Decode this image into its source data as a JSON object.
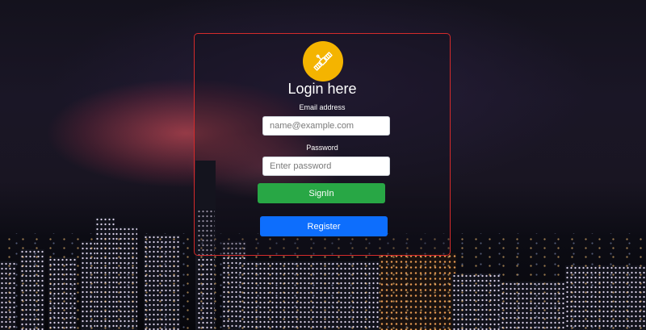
{
  "login": {
    "title": "Login here",
    "email_label": "Email address",
    "email_placeholder": "name@example.com",
    "email_value": "",
    "password_label": "Password",
    "password_placeholder": "Enter password",
    "password_value": "",
    "signin_label": "SignIn",
    "register_label": "Register",
    "logo_icon": "satellite-icon"
  },
  "colors": {
    "card_border": "#d42b2b",
    "logo_bg": "#f4b400",
    "signin_bg": "#28a745",
    "register_bg": "#0d6efd"
  }
}
